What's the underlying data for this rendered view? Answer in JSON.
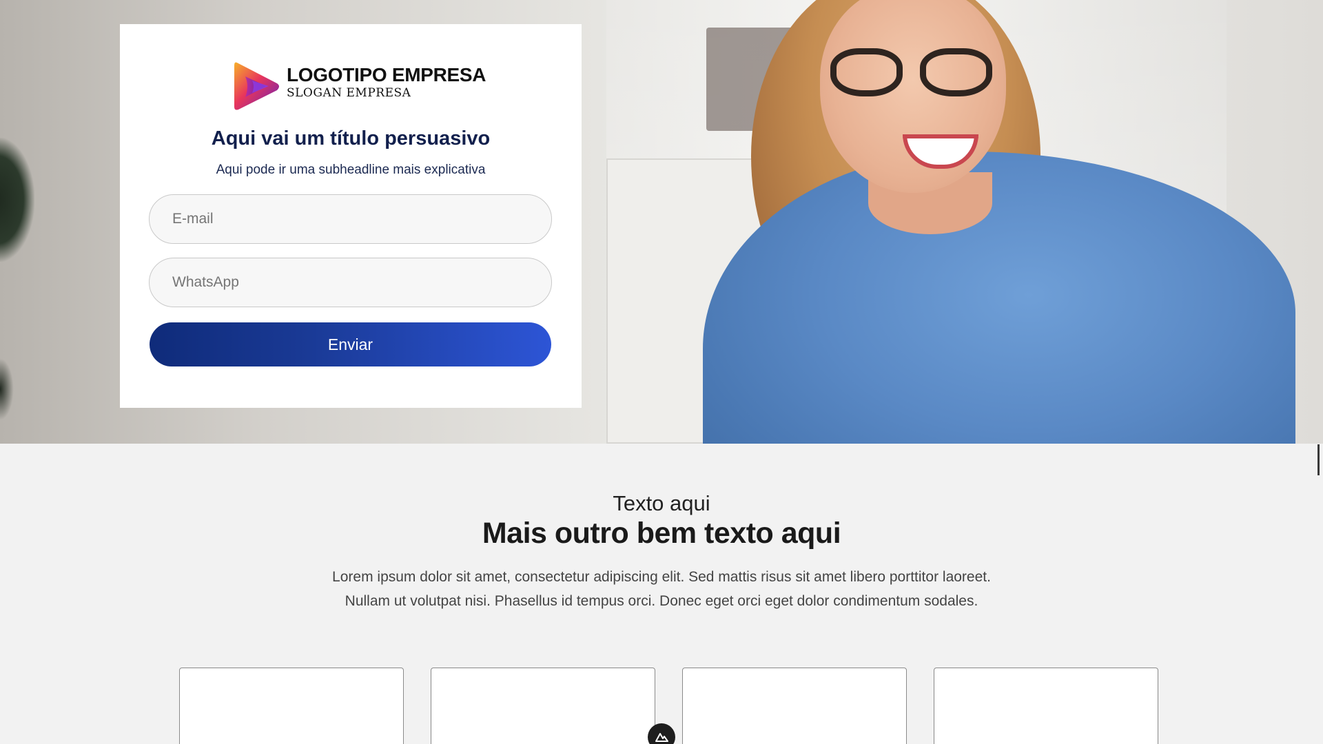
{
  "form": {
    "logo_title": "LOGOTIPO EMPRESA",
    "logo_slogan": "SLOGAN EMPRESA",
    "headline": "Aqui vai um título persuasivo",
    "subheadline": "Aqui pode ir uma subheadline mais explicativa",
    "email_placeholder": "E-mail",
    "whatsapp_placeholder": "WhatsApp",
    "submit_label": "Enviar"
  },
  "section": {
    "kicker": "Texto aqui",
    "title": "Mais outro bem texto aqui",
    "body": "Lorem ipsum dolor sit amet, consectetur adipiscing elit. Sed mattis risus sit amet libero porttitor laoreet. Nullam ut volutpat nisi. Phasellus id tempus orci. Donec eget orci eget dolor condimentum sodales."
  },
  "colors": {
    "button_gradient_start": "#0f2b7a",
    "button_gradient_end": "#2d55d6",
    "headline": "#12204d",
    "page_background": "#f2f2f2"
  },
  "icons": {
    "logo": "play-triangle-logo-icon",
    "badge": "editor-badge-icon"
  }
}
